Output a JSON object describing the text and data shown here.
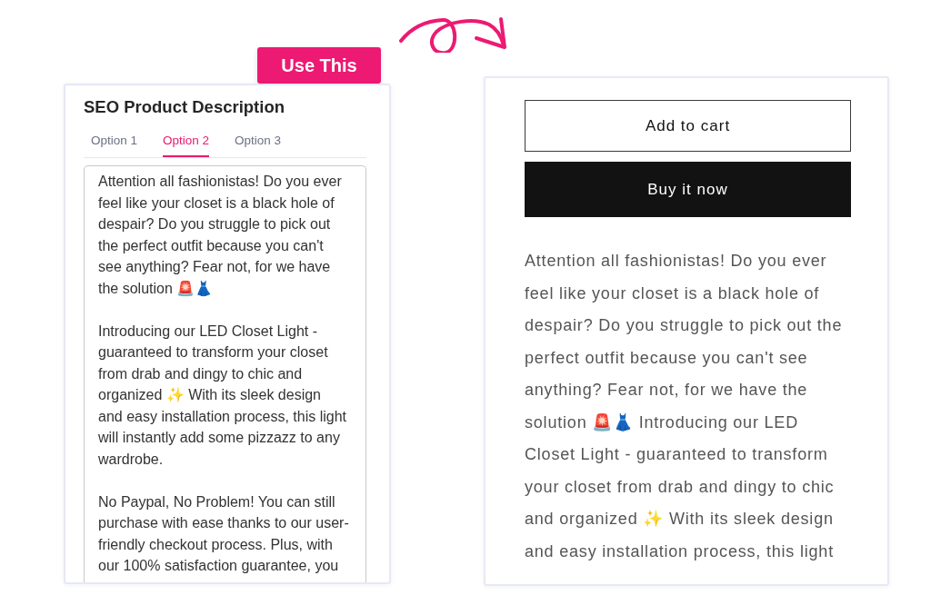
{
  "use_button": {
    "label": "Use This"
  },
  "generator_panel": {
    "title": "SEO Product Description",
    "tabs": [
      {
        "label": "Option 1",
        "selected": false
      },
      {
        "label": "Option 2",
        "selected": true
      },
      {
        "label": "Option 3",
        "selected": false
      }
    ],
    "description_field": {
      "paragraphs": [
        "Attention all fashionistas! Do you ever feel like your closet is a black hole of despair? Do you struggle to pick out the perfect outfit because you can't see anything? Fear not, for we have the solution 🚨👗",
        "Introducing our LED Closet Light - guaranteed to transform your closet from drab and dingy to chic and organized ✨ With its sleek design and easy installation process, this light will instantly add some pizzazz to any wardrobe.",
        "No Paypal, No Problem! You can still purchase with ease thanks to our user-friendly checkout process. Plus, with our 100% satisfaction guarantee, you"
      ]
    }
  },
  "product_page": {
    "buttons": [
      {
        "label": "Add to cart",
        "kind": "outline"
      },
      {
        "label": "Buy it now",
        "kind": "solid"
      }
    ],
    "description": "Attention all fashionistas! Do you ever feel like your closet is a black hole of despair? Do you struggle to pick out the perfect outfit because you can't see anything? Fear not, for we have the solution 🚨👗 Introducing our LED Closet Light - guaranteed to transform your closet from drab and dingy to chic and organized ✨ With its sleek design and easy installation process, this light"
  }
}
